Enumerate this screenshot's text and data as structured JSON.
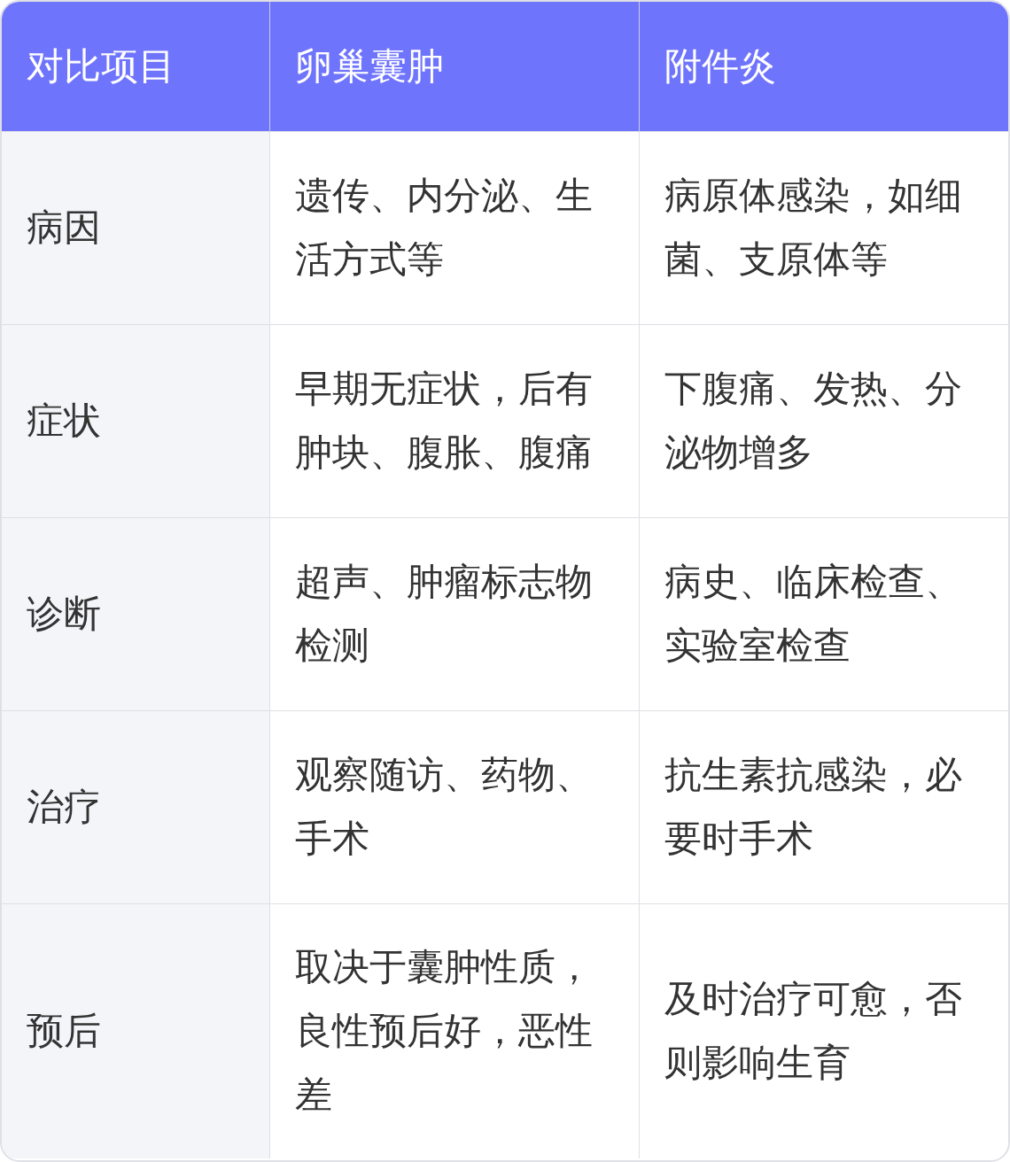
{
  "table": {
    "columns": [
      "对比项目",
      "卵巢囊肿",
      "附件炎"
    ],
    "rows": [
      {
        "cells": [
          "病因",
          "遗传、内分泌、生活方式等",
          "病原体感染，如细菌、支原体等"
        ]
      },
      {
        "cells": [
          "症状",
          "早期无症状，后有肿块、腹胀、腹痛",
          "下腹痛、发热、分泌物增多"
        ]
      },
      {
        "cells": [
          "诊断",
          "超声、肿瘤标志物检测",
          "病史、临床检查、实验室检查"
        ]
      },
      {
        "cells": [
          "治疗",
          "观察随访、药物、手术",
          "抗生素抗感染，必要时手术"
        ]
      },
      {
        "cells": [
          "预后",
          "取决于囊肿性质，良性预后好，恶性差",
          "及时治疗可愈，否则影响生育"
        ]
      }
    ]
  }
}
